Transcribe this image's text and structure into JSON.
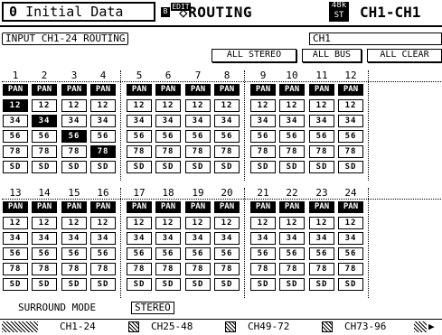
{
  "header": {
    "scene_number": "0",
    "scene_name": "Initial Data",
    "b_badge": "B",
    "edit_badge": "EDIT",
    "page_title": "◇ROUTING",
    "fs_top": "48k",
    "fs_bottom": "ST",
    "channel_title": "CH1-CH1"
  },
  "page_label": "INPUT CH1-24 ROUTING",
  "channel_field": "CH1",
  "buttons": {
    "all_stereo": "ALL STEREO",
    "all_bus": "ALL BUS",
    "all_clear": "ALL CLEAR"
  },
  "pan_label": "PAN",
  "row_labels": [
    "12",
    "34",
    "56",
    "78",
    "SD"
  ],
  "channels": [
    {
      "num": "1",
      "active": {
        "0": 1
      }
    },
    {
      "num": "2",
      "active": {
        "1": 1
      }
    },
    {
      "num": "3",
      "active": {
        "2": 1
      }
    },
    {
      "num": "4",
      "active": {
        "3": 1
      }
    },
    {
      "num": "5"
    },
    {
      "num": "6"
    },
    {
      "num": "7"
    },
    {
      "num": "8"
    },
    {
      "num": "9"
    },
    {
      "num": "10"
    },
    {
      "num": "11"
    },
    {
      "num": "12"
    },
    {
      "num": "13"
    },
    {
      "num": "14"
    },
    {
      "num": "15"
    },
    {
      "num": "16"
    },
    {
      "num": "17"
    },
    {
      "num": "18"
    },
    {
      "num": "19"
    },
    {
      "num": "20"
    },
    {
      "num": "21"
    },
    {
      "num": "22"
    },
    {
      "num": "23"
    },
    {
      "num": "24"
    }
  ],
  "surround": {
    "label": "SURROUND MODE",
    "value": "STEREO"
  },
  "tabs": [
    "CH1-24",
    "CH25-48",
    "CH49-72",
    "CH73-96"
  ]
}
